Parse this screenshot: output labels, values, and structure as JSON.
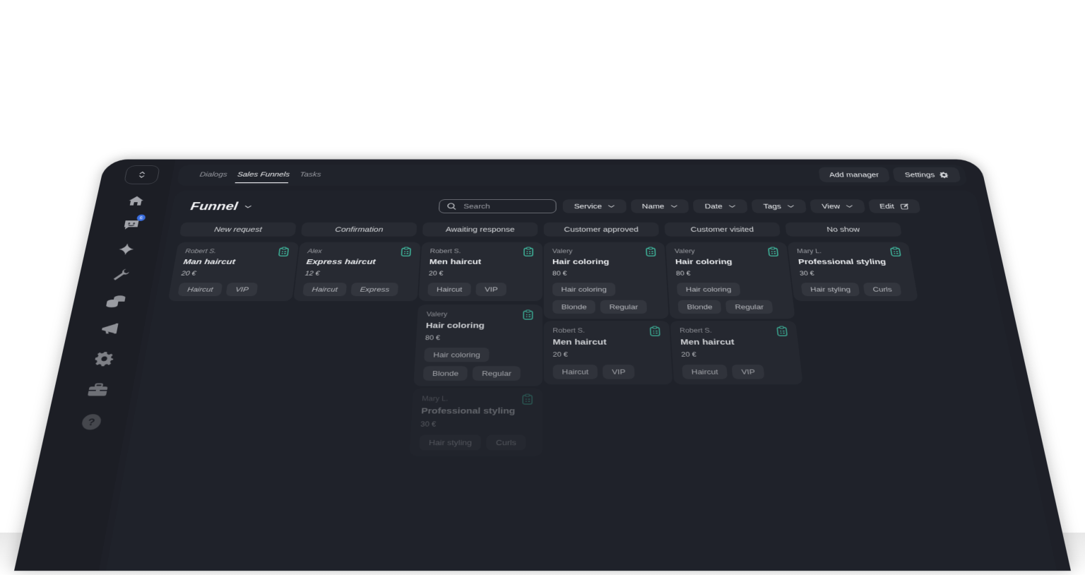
{
  "sidebar": {
    "collapse_icon": "chevrons-up-down-icon",
    "items": [
      {
        "icon": "home-icon"
      },
      {
        "icon": "chat-smile-icon",
        "badge": "6"
      },
      {
        "icon": "sparkle-icon"
      },
      {
        "icon": "wrench-icon"
      },
      {
        "icon": "coins-icon"
      },
      {
        "icon": "megaphone-icon"
      },
      {
        "icon": "gear-icon"
      },
      {
        "icon": "briefcase-icon"
      },
      {
        "icon": "help-icon"
      }
    ]
  },
  "topbar": {
    "tabs": [
      {
        "label": "Dialogs",
        "active": false
      },
      {
        "label": "Sales Funnels",
        "active": true
      },
      {
        "label": "Tasks",
        "active": false
      }
    ],
    "add_manager_label": "Add manager",
    "settings_label": "Settings"
  },
  "toolbar": {
    "funnel_label": "Funnel",
    "search_placeholder": "Search",
    "filters": [
      "Service",
      "Name",
      "Date",
      "Tags",
      "View"
    ],
    "edit_label": "Edit"
  },
  "columns": [
    {
      "title": "New request",
      "cards": [
        {
          "client": "Robert S.",
          "service": "Man haircut",
          "price": "20 €",
          "tags": [
            "Haircut",
            "VIP"
          ]
        }
      ]
    },
    {
      "title": "Confirmation",
      "cards": [
        {
          "client": "Alex",
          "service": "Express haircut",
          "price": "12 €",
          "tags": [
            "Haircut",
            "Express"
          ]
        }
      ]
    },
    {
      "title": "Awaiting response",
      "cards": [
        {
          "client": "Robert S.",
          "service": "Men haircut",
          "price": "20 €",
          "tags": [
            "Haircut",
            "VIP"
          ]
        },
        {
          "client": "Valery",
          "service": "Hair coloring",
          "price": "80 €",
          "tags": [
            "Hair coloring",
            "Blonde",
            "Regular"
          ]
        },
        {
          "client": "Mary L.",
          "service": "Professional styling",
          "price": "30 €",
          "tags": [
            "Hair styling",
            "Curls"
          ]
        }
      ]
    },
    {
      "title": "Customer approved",
      "cards": [
        {
          "client": "Valery",
          "service": "Hair coloring",
          "price": "80 €",
          "tags": [
            "Hair coloring",
            "Blonde",
            "Regular"
          ]
        },
        {
          "client": "Robert S.",
          "service": "Men haircut",
          "price": "20 €",
          "tags": [
            "Haircut",
            "VIP"
          ]
        }
      ]
    },
    {
      "title": "Customer visited",
      "cards": [
        {
          "client": "Valery",
          "service": "Hair coloring",
          "price": "80 €",
          "tags": [
            "Hair coloring",
            "Blonde",
            "Regular"
          ]
        },
        {
          "client": "Robert S.",
          "service": "Men haircut",
          "price": "20 €",
          "tags": [
            "Haircut",
            "VIP"
          ]
        }
      ]
    },
    {
      "title": "No show",
      "cards": [
        {
          "client": "Mary L.",
          "service": "Professional styling",
          "price": "30 €",
          "tags": [
            "Hair styling",
            "Curls"
          ]
        }
      ]
    }
  ],
  "colors": {
    "accent_icon": "#3fb39a",
    "badge": "#3b6fe0",
    "background": "#1e2028"
  }
}
